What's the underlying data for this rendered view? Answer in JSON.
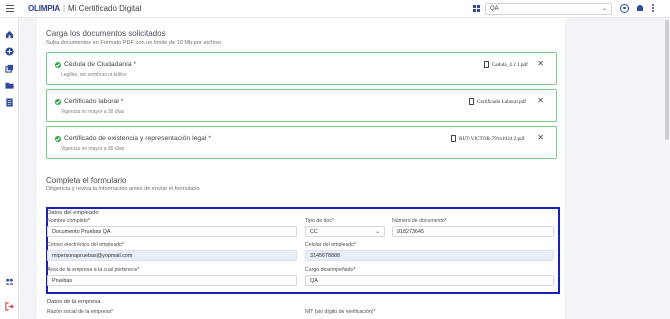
{
  "header": {
    "logo": "OLIMPIA",
    "separator": "|",
    "app_title": "Mi Certificado Digital",
    "env_select": "QA"
  },
  "upload": {
    "title": "Carga los documentos solicitados",
    "subtitle": "Suba documentos en Formato PDF con un límite de 10 Mb por archivo",
    "documents": [
      {
        "name": "Cédula de Ciudadanía *",
        "hint": "Legible, sin sombras ni brillos",
        "file": "Cedula_4 2 1.pdf"
      },
      {
        "name": "Certificado laboral *",
        "hint": "Vigencia no mayor a 30 días",
        "file": "Certificado Laboral.pdf"
      },
      {
        "name": "Certificado de existencia y representación legal *",
        "hint": "Vigencia no mayor a 30 días",
        "file": "RUT-VICTOR-791n1024 2.pdf"
      }
    ]
  },
  "form": {
    "title": "Completa el formulario",
    "subtitle": "Diligencia y revisa la información antes de enviar el formulario",
    "employee_section": "Datos del empleado",
    "full_name_label": "Nombre completo*",
    "full_name_value": "Documento Pruebas QA",
    "doc_type_label": "Tipo de doc*",
    "doc_type_value": "CC",
    "doc_number_label": "Número de documento*",
    "doc_number_value": "918273645",
    "email_label": "Correo electrónico del empleado*",
    "email_value": "mipersonapruebas@yopmail.com",
    "phone_label": "Celular del empleado*",
    "phone_value": "3145678888",
    "area_label": "Área de la empresa a la cual pertenece*",
    "area_value": "Pruebas",
    "position_label": "Cargo desempeñado*",
    "position_value": "QA",
    "company_section": "Datos de la empresa",
    "company_name_label": "Razón social de la empresa*",
    "nit_label": "NIT (sin dígito de verificación)*"
  },
  "colors": {
    "accent": "#2e4a9a",
    "success": "#3aa54a",
    "success_border": "#7dc98a",
    "highlight_border": "#1b1fb6",
    "logout": "#d9363e"
  },
  "icons": {
    "sidebar": [
      "home-icon",
      "add-circle-icon",
      "copy-icon",
      "folder-icon",
      "document-icon",
      "group-icon",
      "logout-icon"
    ],
    "topbar": [
      "apps-icon",
      "user-icon",
      "bell-icon",
      "more-icon"
    ]
  }
}
